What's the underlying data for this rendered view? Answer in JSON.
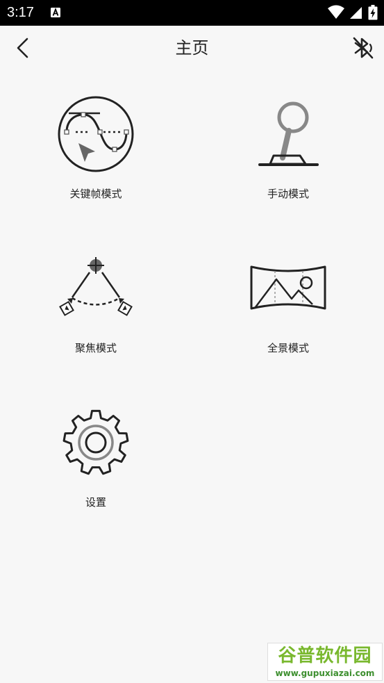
{
  "status_bar": {
    "time": "3:17",
    "notification_icon": "font-a-icon",
    "icons": [
      "wifi-icon",
      "signal-icon",
      "battery-charging-icon"
    ]
  },
  "app_bar": {
    "title": "主页",
    "back_icon": "back-chevron-icon",
    "bluetooth_icon": "bluetooth-disabled-icon"
  },
  "menu": {
    "items": [
      {
        "label": "关键帧模式",
        "icon": "keyframe-curve-icon"
      },
      {
        "label": "手动模式",
        "icon": "joystick-icon"
      },
      {
        "label": "聚焦模式",
        "icon": "focus-arc-icon"
      },
      {
        "label": "全景模式",
        "icon": "panorama-icon"
      },
      {
        "label": "设置",
        "icon": "gear-icon"
      }
    ]
  },
  "watermark": {
    "brand": "谷普软件园",
    "url": "www.gupuxiazai.com"
  },
  "colors": {
    "status_bar_bg": "#000000",
    "background": "#f7f7f7",
    "icon_stroke": "#222222",
    "icon_gray": "#888888",
    "watermark_green": "#79b82e"
  }
}
